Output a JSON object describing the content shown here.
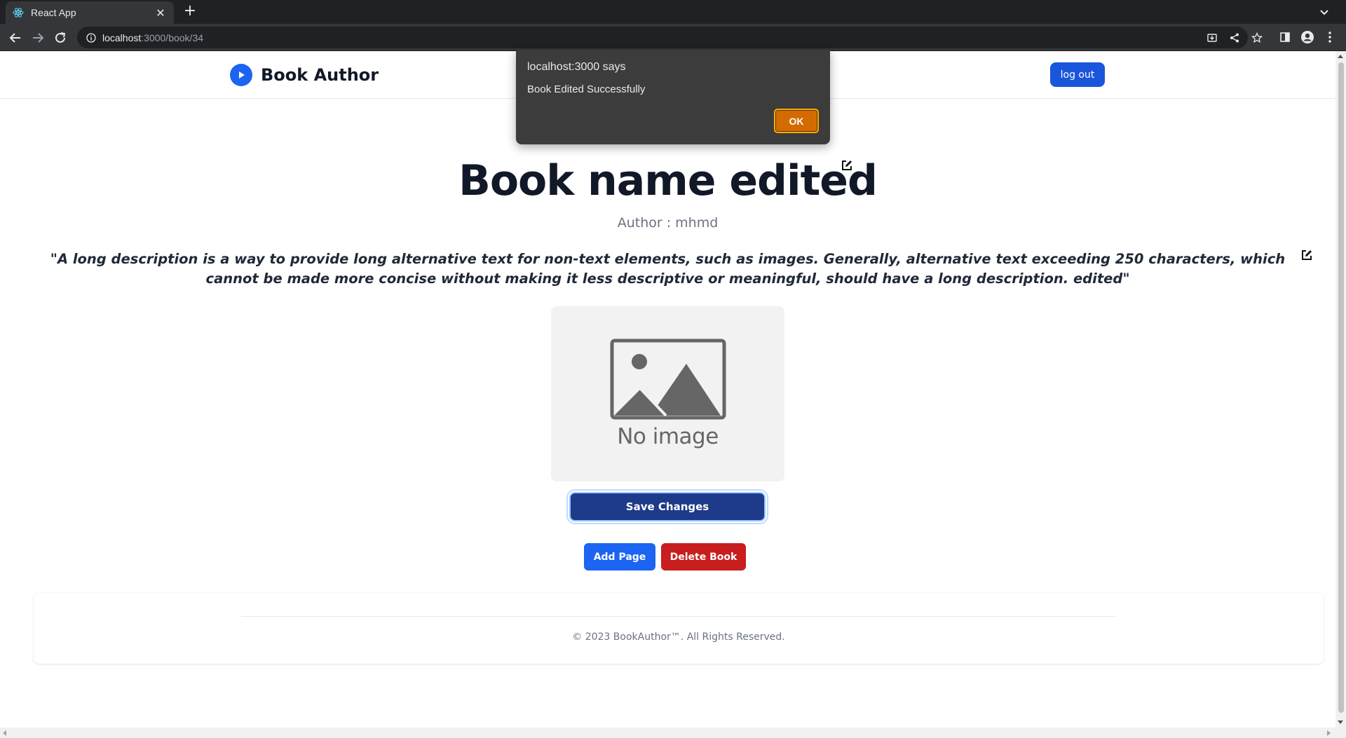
{
  "browser": {
    "tab_title": "React App",
    "url_host": "localhost",
    "url_path": ":3000/book/34"
  },
  "navbar": {
    "brand": "Book Author",
    "logout_label": "log out"
  },
  "book": {
    "title": "Book name edited",
    "author": "Author : mhmd",
    "description": "\"A long description is a way to provide long alternative text for non-text elements, such as images. Generally, alternative text exceeding 250 characters, which cannot be made more concise without making it less descriptive or meaningful, should have a long description. edited\"",
    "cover_placeholder": "No image"
  },
  "actions": {
    "save_label": "Save Changes",
    "add_page_label": "Add Page",
    "delete_label": "Delete Book"
  },
  "footer": {
    "copyright": "© 2023 BookAuthor™. All Rights Reserved."
  },
  "alert": {
    "title": "localhost:3000 says",
    "message": "Book Edited Successfully",
    "ok_label": "OK"
  },
  "colors": {
    "primary": "#1a56db",
    "save_button": "#1e3a8a",
    "delete_button": "#c81e1e",
    "alert_ok": "#d36b00"
  }
}
